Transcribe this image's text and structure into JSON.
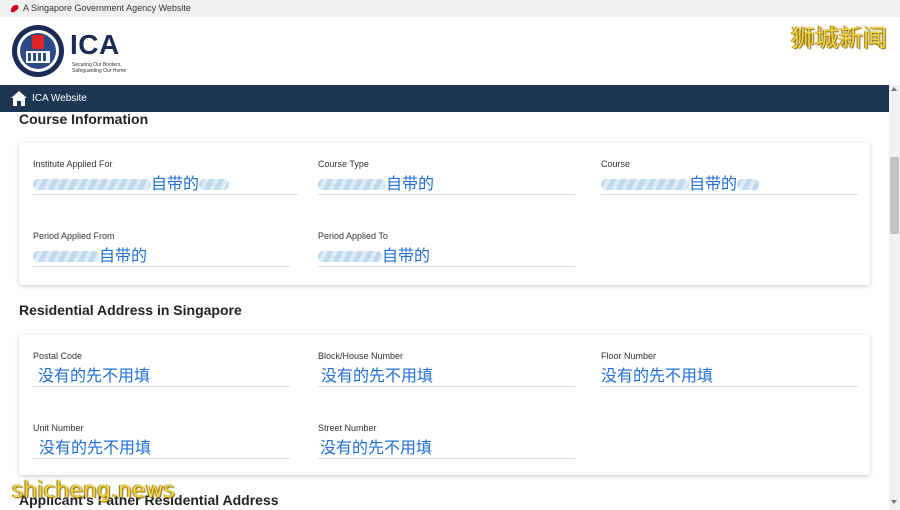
{
  "gov_banner": {
    "text": "A Singapore Government Agency Website"
  },
  "brand": {
    "logo_text": "ICA",
    "tagline": "Securing Our Borders,\nSafeguarding Our Home"
  },
  "watermarks": {
    "top": "狮城新闻",
    "bottom": "shicheng.news"
  },
  "nav": {
    "home_link": "ICA Website"
  },
  "course": {
    "title": "Course Information",
    "fields": {
      "institute": {
        "label": "Institute Applied For",
        "note": "自带的"
      },
      "course_type": {
        "label": "Course Type",
        "note": "自带的"
      },
      "course": {
        "label": "Course",
        "note": "自带的"
      },
      "period_from": {
        "label": "Period Applied From",
        "note": "自带的"
      },
      "period_to": {
        "label": "Period Applied To",
        "note": "自带的"
      }
    }
  },
  "address": {
    "title": "Residential Address in Singapore",
    "fields": {
      "postal_code": {
        "label": "Postal Code",
        "note": "没有的先不用填"
      },
      "block": {
        "label": "Block/House Number",
        "note": "没有的先不用填"
      },
      "floor": {
        "label": "Floor Number",
        "note": "没有的先不用填"
      },
      "unit": {
        "label": "Unit Number",
        "note": "没有的先不用填"
      },
      "street": {
        "label": "Street Number",
        "note": "没有的先不用填"
      }
    }
  },
  "next_section": {
    "title": "Applicant's Father Residential Address"
  },
  "colors": {
    "navbar": "#1c3654",
    "annotation": "#1f6fd6",
    "watermark": "#f2d54a",
    "brand": "#1a2b55"
  },
  "icons": [
    "lion-icon",
    "ica-crest-icon",
    "home-icon"
  ]
}
